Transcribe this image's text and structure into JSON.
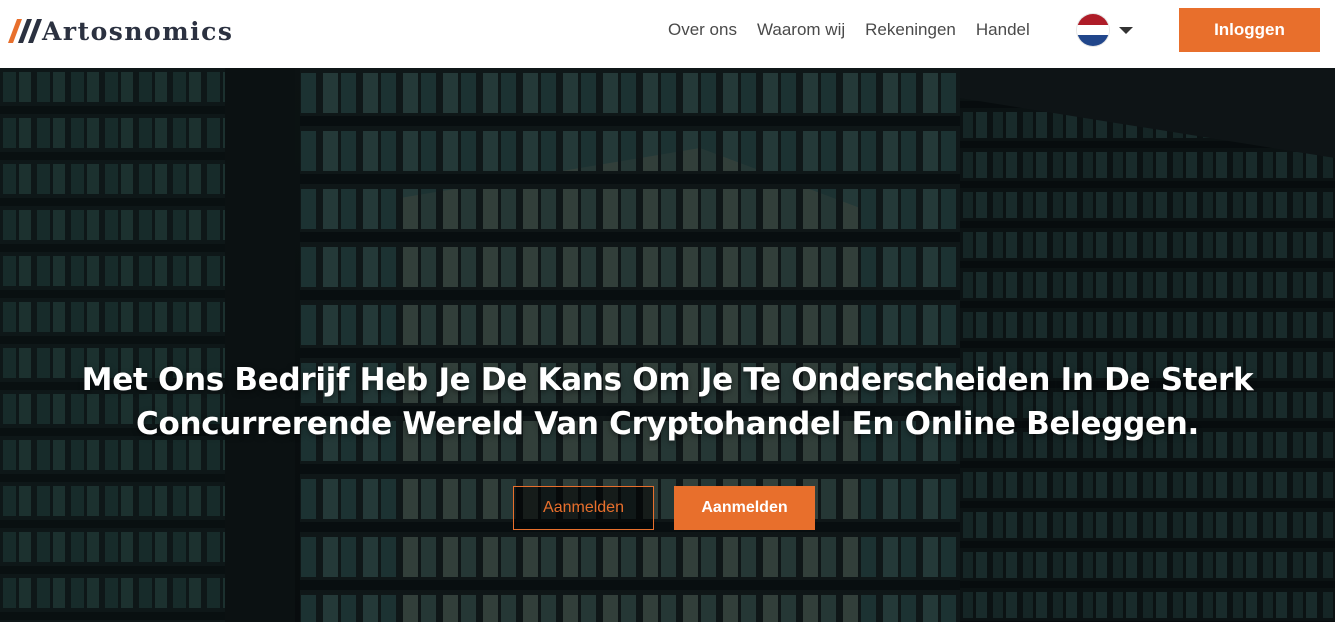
{
  "brand": {
    "name": "Artosnomics",
    "accent_color": "#e86f2c"
  },
  "nav": {
    "items": [
      {
        "label": "Over ons"
      },
      {
        "label": "Waarom wij"
      },
      {
        "label": "Rekeningen"
      },
      {
        "label": "Handel"
      }
    ],
    "language": {
      "icon": "netherlands-flag-icon",
      "colors": [
        "#ae1c28",
        "#ffffff",
        "#21468b"
      ]
    },
    "login_label": "Inloggen"
  },
  "hero": {
    "title_line1": "Met Ons Bedrijf Heb Je De Kans Om Je Te Onderscheiden In De Sterk",
    "title_line2": "Concurrerende Wereld Van Cryptohandel En Online Beleggen.",
    "primary_button": "Aanmelden",
    "secondary_button": "Aanmelden",
    "background": "night-office-building-photo"
  }
}
